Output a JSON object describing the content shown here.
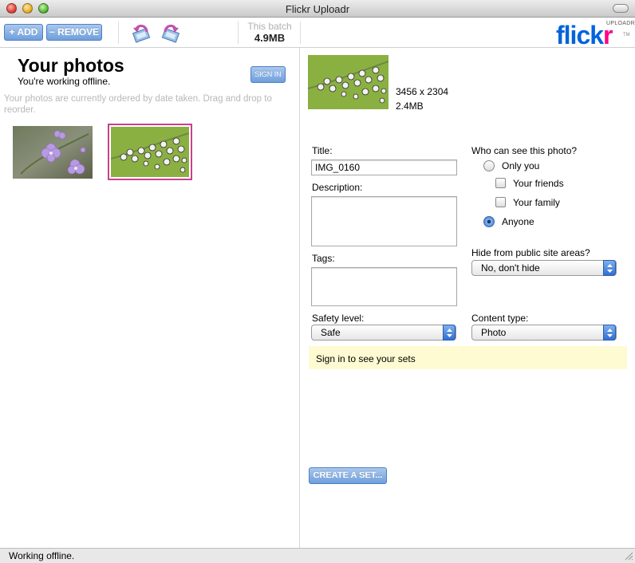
{
  "window": {
    "title": "Flickr Uploadr"
  },
  "toolbar": {
    "add_label": "+ ADD",
    "remove_label": "− REMOVE",
    "batch_label": "This batch",
    "batch_size": "4.9MB"
  },
  "logo": {
    "word_blue": "flick",
    "word_pink": "r",
    "sub": "UPLOADR",
    "tm": "TM"
  },
  "left": {
    "heading": "Your photos",
    "subheading": "You're working offline.",
    "signin_label": "SIGN IN",
    "hint": "Your photos are currently ordered by date taken. Drag and drop to reorder."
  },
  "photo": {
    "dimensions": "3456 x 2304",
    "size": "2.4MB"
  },
  "form": {
    "title_label": "Title:",
    "title_value": "IMG_0160",
    "description_label": "Description:",
    "tags_label": "Tags:",
    "privacy_label": "Who can see this photo?",
    "opt_only_you": "Only you",
    "opt_friends": "Your friends",
    "opt_family": "Your family",
    "opt_anyone": "Anyone",
    "hide_label": "Hide from public site areas?",
    "hide_value": "No, don't hide",
    "safety_label": "Safety level:",
    "safety_value": "Safe",
    "content_label": "Content type:",
    "content_value": "Photo",
    "sets_note": "Sign in to see your sets",
    "create_set_label": "CREATE A SET..."
  },
  "status": {
    "text": "Working offline."
  },
  "colors": {
    "accent_blue": "#6f9fdc",
    "selection_pink": "#c94090",
    "flickr_blue": "#0063dc",
    "flickr_pink": "#ff0084",
    "note_bg": "#fefbd2"
  }
}
